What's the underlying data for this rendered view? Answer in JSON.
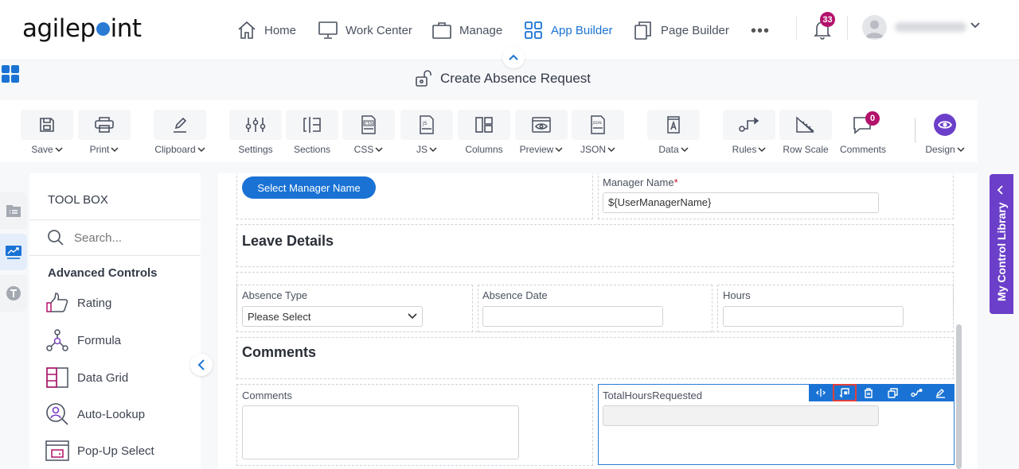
{
  "brand": {
    "logo_pre": "agilep",
    "logo_post": "int",
    "accent": "#1a73d4",
    "badge_color": "#b3126b",
    "library_color": "#6b3fc9"
  },
  "nav": {
    "items": [
      {
        "label": "Home",
        "icon": "home-icon"
      },
      {
        "label": "Work Center",
        "icon": "monitor-icon"
      },
      {
        "label": "Manage",
        "icon": "briefcase-icon"
      },
      {
        "label": "App Builder",
        "icon": "grid-icon",
        "active": true
      },
      {
        "label": "Page Builder",
        "icon": "pages-icon"
      }
    ],
    "more": "•••",
    "notifications_count": "33"
  },
  "page": {
    "title": "Create Absence Request"
  },
  "toolbar": {
    "items": [
      {
        "label": "Save",
        "dropdown": true
      },
      {
        "label": "Print",
        "dropdown": true
      },
      {
        "label": "Clipboard",
        "dropdown": true
      },
      {
        "label": "Settings",
        "dropdown": false
      },
      {
        "label": "Sections",
        "dropdown": false
      },
      {
        "label": "CSS",
        "dropdown": true
      },
      {
        "label": "JS",
        "dropdown": true
      },
      {
        "label": "Columns",
        "dropdown": false
      },
      {
        "label": "Preview",
        "dropdown": true
      },
      {
        "label": "JSON",
        "dropdown": true
      },
      {
        "label": "Data",
        "dropdown": true
      },
      {
        "label": "Rules",
        "dropdown": true
      },
      {
        "label": "Row Scale",
        "dropdown": false
      },
      {
        "label": "Comments",
        "dropdown": false,
        "badge": "0"
      },
      {
        "label": "Design",
        "dropdown": true
      }
    ]
  },
  "toolbox": {
    "title": "TOOL BOX",
    "search_placeholder": "Search...",
    "section": "Advanced Controls",
    "items": [
      {
        "label": "Rating",
        "icon": "thumbs-up-icon"
      },
      {
        "label": "Formula",
        "icon": "formula-icon"
      },
      {
        "label": "Data Grid",
        "icon": "data-grid-icon"
      },
      {
        "label": "Auto-Lookup",
        "icon": "auto-lookup-icon"
      },
      {
        "label": "Pop-Up Select",
        "icon": "popup-select-icon"
      }
    ]
  },
  "form": {
    "select_manager_button": "Select Manager Name",
    "manager_name_label": "Manager Name",
    "required_mark": "*",
    "manager_name_value": "${UserManagerName}",
    "leave_details_heading": "Leave Details",
    "absence_type_label": "Absence Type",
    "absence_type_value": "Please Select",
    "absence_date_label": "Absence Date",
    "absence_date_value": "",
    "hours_label": "Hours",
    "hours_value": "",
    "comments_heading": "Comments",
    "comments_label": "Comments",
    "comments_value": "",
    "total_hours_label": "TotalHoursRequested",
    "total_hours_value": ""
  },
  "control_actions": [
    {
      "name": "resize-icon"
    },
    {
      "name": "field-mapping-icon",
      "highlighted": true
    },
    {
      "name": "delete-icon"
    },
    {
      "name": "duplicate-icon"
    },
    {
      "name": "rules-icon"
    },
    {
      "name": "edit-icon"
    }
  ],
  "library_tab": {
    "label": "My Control Library"
  }
}
